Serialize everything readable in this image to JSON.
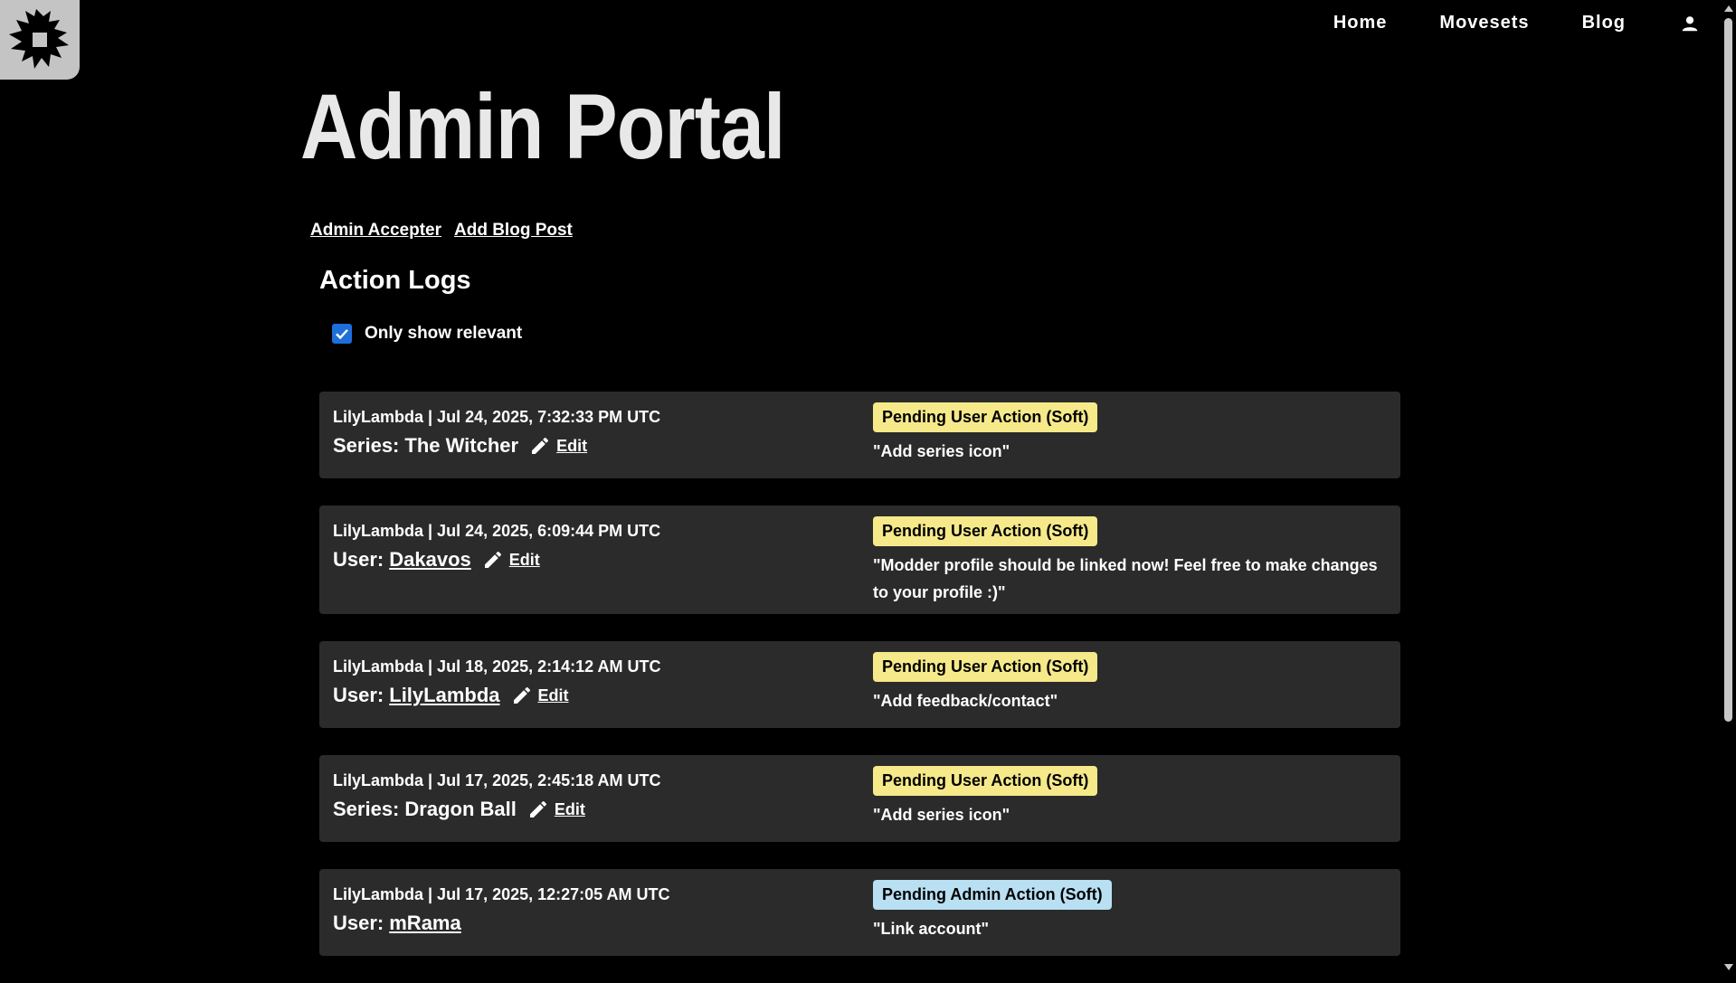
{
  "nav": {
    "items": [
      "Home",
      "Movesets",
      "Blog"
    ]
  },
  "page": {
    "title": "Admin Portal"
  },
  "admin_links": [
    "Admin Accepter",
    "Add Blog Post"
  ],
  "action_logs": {
    "title": "Action Logs",
    "filter_label": "Only show relevant",
    "filter_checked": true
  },
  "logs": [
    {
      "meta": "LilyLambda | Jul 24, 2025, 7:32:33 PM UTC",
      "subject_label": "Series:",
      "subject_value": "The Witcher",
      "link": false,
      "edit_label": "Edit",
      "status": "Pending User Action (Soft)",
      "note": "\"Add series icon\""
    },
    {
      "meta": "LilyLambda | Jul 24, 2025, 6:09:44 PM UTC",
      "subject_label": "User:",
      "subject_value": "Dakavos",
      "link": true,
      "edit_label": "Edit",
      "status": "Pending User Action (Soft)",
      "note": "\"Modder profile should be linked now! Feel free to make changes to your profile :)\""
    },
    {
      "meta": "LilyLambda | Jul 18, 2025, 2:14:12 AM UTC",
      "subject_label": "User:",
      "subject_value": "LilyLambda",
      "link": true,
      "edit_label": "Edit",
      "status": "Pending User Action (Soft)",
      "note": "\"Add feedback/contact\""
    },
    {
      "meta": "LilyLambda | Jul 17, 2025, 2:45:18 AM UTC",
      "subject_label": "Series:",
      "subject_value": "Dragon Ball",
      "link": false,
      "edit_label": "Edit",
      "status": "Pending User Action (Soft)",
      "note": "\"Add series icon\""
    },
    {
      "meta": "LilyLambda | Jul 17, 2025, 12:27:05 AM UTC",
      "subject_label": "User:",
      "subject_value": "mRama",
      "link": true,
      "edit_label": "",
      "status": "Pending Admin Action (Soft)",
      "note": "\"Link account\""
    }
  ],
  "colors": {
    "badge_user": "#f6e98a",
    "badge_admin": "#b8dff2",
    "card": "#2b2b2b",
    "checkbox": "#1e6fd9"
  },
  "icons": {
    "logo": "splat-logo-icon",
    "user": "person-icon",
    "edit": "pencil-icon",
    "checkbox": "checkmark-icon"
  }
}
